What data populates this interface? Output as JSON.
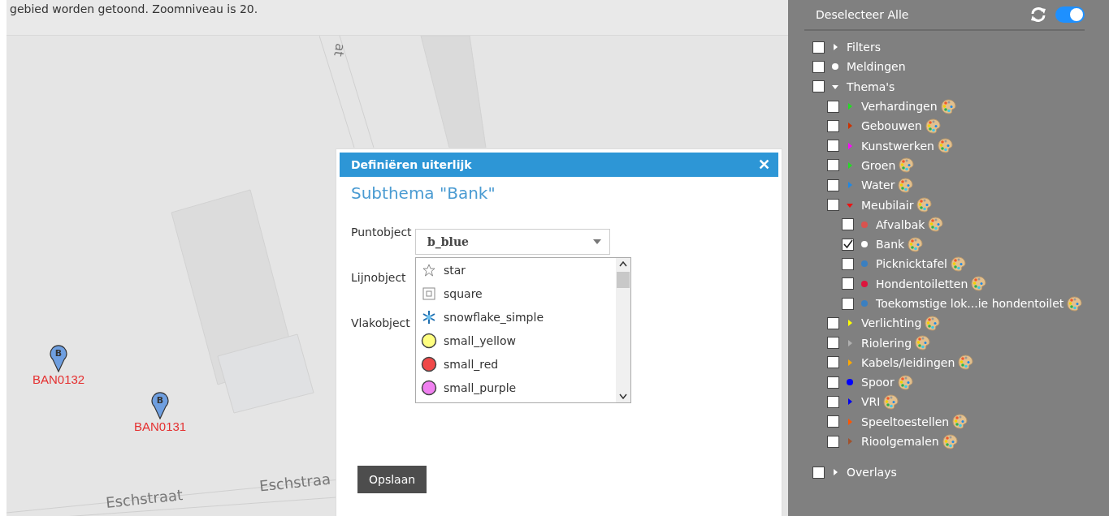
{
  "notice": "gebied worden getoond. Zoomniveau is 20.",
  "map": {
    "street_labels": [
      {
        "text": "at",
        "kind": "vertical"
      },
      {
        "text": "Eschstraat",
        "kind": "left"
      },
      {
        "text": "Eschstraa",
        "kind": "right"
      }
    ],
    "pins": [
      {
        "letter": "B",
        "label": "BAN0132"
      },
      {
        "letter": "B",
        "label": "BAN0131"
      }
    ]
  },
  "dialog": {
    "title": "Definiëren uiterlijk",
    "close": "✕",
    "subtitle": "Subthema \"Bank\"",
    "fields": [
      {
        "label": "Puntobject"
      },
      {
        "label": "Lijnobject"
      },
      {
        "label": "Vlakobject"
      }
    ],
    "select": {
      "value": "b_blue",
      "options": [
        {
          "label": "star",
          "kind": "star"
        },
        {
          "label": "square",
          "kind": "square"
        },
        {
          "label": "snowflake_simple",
          "kind": "snowflake"
        },
        {
          "label": "small_yellow",
          "kind": "circle",
          "color": "#ffff80"
        },
        {
          "label": "small_red",
          "kind": "circle",
          "color": "#f04848"
        },
        {
          "label": "small_purple",
          "kind": "circle",
          "color": "#f080f0"
        }
      ]
    },
    "save": "Opslaan"
  },
  "sidebar": {
    "deselect": "Deselecteer Alle",
    "toggle_on": true,
    "tree": [
      {
        "label": "Filters",
        "checked": false,
        "kind": "triangle",
        "expanded": false,
        "color": "#ffffff",
        "palette": false
      },
      {
        "label": "Meldingen",
        "checked": false,
        "kind": "dot",
        "color": "#ffffff",
        "palette": false
      },
      {
        "label": "Thema's",
        "checked": false,
        "kind": "triangle",
        "expanded": true,
        "color": "#ffffff",
        "palette": false,
        "children": [
          {
            "label": "Verhardingen",
            "checked": false,
            "kind": "triangle",
            "expanded": false,
            "color": "#22dd22",
            "palette": true
          },
          {
            "label": "Gebouwen",
            "checked": false,
            "kind": "triangle",
            "expanded": false,
            "color": "#cc3300",
            "palette": true
          },
          {
            "label": "Kunstwerken",
            "checked": false,
            "kind": "triangle",
            "expanded": false,
            "color": "#ff00ff",
            "palette": true
          },
          {
            "label": "Groen",
            "checked": false,
            "kind": "triangle",
            "expanded": false,
            "color": "#22dd22",
            "palette": true
          },
          {
            "label": "Water",
            "checked": false,
            "kind": "triangle",
            "expanded": false,
            "color": "#1e88e5",
            "palette": true
          },
          {
            "label": "Meubilair",
            "checked": false,
            "kind": "triangle",
            "expanded": true,
            "color": "#ee1111",
            "palette": true,
            "children": [
              {
                "label": "Afvalbak",
                "checked": false,
                "kind": "dot",
                "color": "#d9534f",
                "palette": true
              },
              {
                "label": "Bank",
                "checked": true,
                "kind": "dot",
                "color": "#ffffff",
                "palette": true
              },
              {
                "label": "Picknicktafel",
                "checked": false,
                "kind": "dot",
                "color": "#3a7fc0",
                "palette": true
              },
              {
                "label": "Hondentoiletten",
                "checked": false,
                "kind": "dot",
                "color": "#dc143c",
                "palette": true
              },
              {
                "label": "Toekomstige lok...ie hondentoilet",
                "checked": false,
                "kind": "dot",
                "color": "#3a7fc0",
                "palette": true
              }
            ]
          },
          {
            "label": "Verlichting",
            "checked": false,
            "kind": "triangle",
            "expanded": false,
            "color": "#ffff00",
            "palette": true
          },
          {
            "label": "Riolering",
            "checked": false,
            "kind": "triangle",
            "expanded": false,
            "color": "#b0b0b0",
            "palette": true
          },
          {
            "label": "Kabels/leidingen",
            "checked": false,
            "kind": "triangle",
            "expanded": false,
            "color": "#ffaa00",
            "palette": true
          },
          {
            "label": "Spoor",
            "checked": false,
            "kind": "dot",
            "color": "#0000ff",
            "palette": true
          },
          {
            "label": "VRI",
            "checked": false,
            "kind": "triangle",
            "expanded": false,
            "color": "#0000ee",
            "palette": true
          },
          {
            "label": "Speeltoestellen",
            "checked": false,
            "kind": "triangle",
            "expanded": false,
            "color": "#ff5500",
            "palette": true
          },
          {
            "label": "Rioolgemalen",
            "checked": false,
            "kind": "triangle",
            "expanded": false,
            "color": "#a0522d",
            "palette": true
          }
        ]
      },
      {
        "label": "Overlays",
        "checked": false,
        "kind": "triangle",
        "expanded": false,
        "color": "#ffffff",
        "palette": false
      }
    ]
  }
}
